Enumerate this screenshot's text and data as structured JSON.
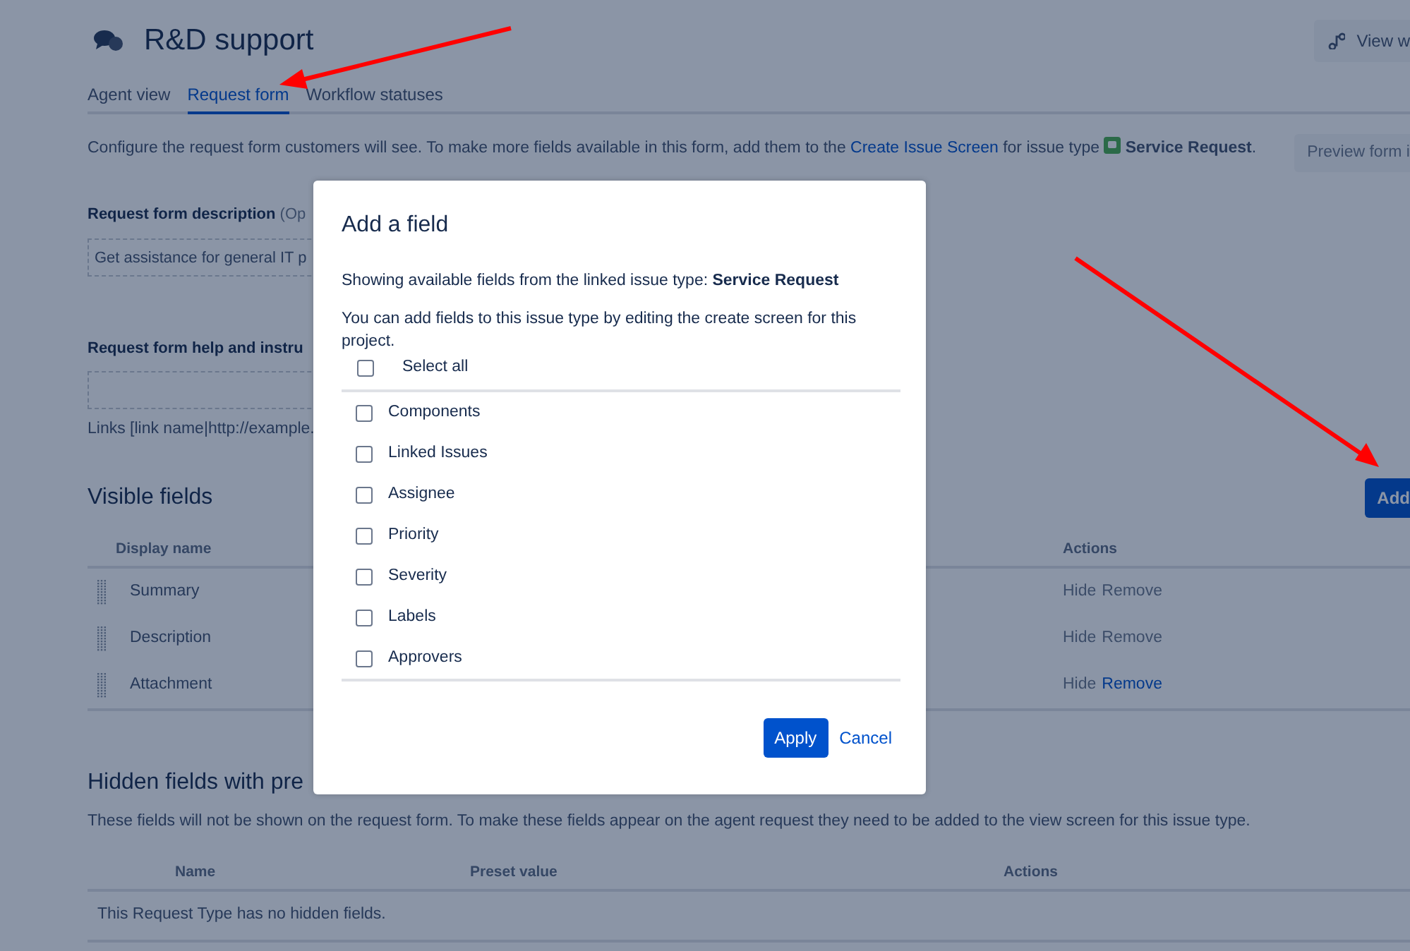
{
  "header": {
    "title": "R&D support",
    "view_button": "View w"
  },
  "tabs": [
    {
      "label": "Agent view",
      "selected": false
    },
    {
      "label": "Request form",
      "selected": true
    },
    {
      "label": "Workflow statuses",
      "selected": false
    }
  ],
  "intro": {
    "text_before": "Configure the request form customers will see. To make more fields available in this form, add them to the",
    "link": "Create Issue Screen",
    "text_after": "for issue type",
    "issue_type": "Service Request",
    "suffix": "."
  },
  "preview_button": "Preview form i",
  "description_field": {
    "label": "Request form description",
    "hint": "(Op",
    "value": "Get assistance for general IT p"
  },
  "help_field": {
    "label": "Request form help and instru",
    "note": "Links [link name|http://example."
  },
  "visible_fields": {
    "title": "Visible fields",
    "add_button": "Add",
    "columns": [
      "Display name",
      "Actions"
    ],
    "rows": [
      {
        "name": "Summary",
        "actions": [
          {
            "label": "Hide",
            "highlighted": false
          },
          {
            "label": "Remove",
            "highlighted": false
          }
        ]
      },
      {
        "name": "Description",
        "actions": [
          {
            "label": "Hide",
            "highlighted": false
          },
          {
            "label": "Remove",
            "highlighted": false
          }
        ]
      },
      {
        "name": "Attachment",
        "actions": [
          {
            "label": "Hide",
            "highlighted": false
          },
          {
            "label": "Remove",
            "highlighted": true
          }
        ]
      }
    ]
  },
  "hidden_fields": {
    "title": "Hidden fields with pre",
    "note": "These fields will not be shown on the request form. To make these fields appear on the agent request they need to be added to the view screen for this issue type.",
    "columns": [
      "Name",
      "Preset value",
      "Actions"
    ],
    "empty_message": "This Request Type has no hidden fields."
  },
  "dialog": {
    "title": "Add a field",
    "source_text": "Showing available fields from the linked issue type: **Service Request**",
    "help_text": "You can add fields to this issue type by editing the create screen for this project.",
    "select_all": {
      "label": "Select all",
      "checked": false
    },
    "fields": [
      {
        "label": "Components",
        "checked": false
      },
      {
        "label": "Linked Issues",
        "checked": false
      },
      {
        "label": "Assignee",
        "checked": false
      },
      {
        "label": "Priority",
        "checked": false
      },
      {
        "label": "Severity",
        "checked": false
      },
      {
        "label": "Labels",
        "checked": false
      },
      {
        "label": "Approvers",
        "checked": false
      }
    ],
    "buttons": {
      "apply": "Apply",
      "cancel": "Cancel"
    }
  }
}
